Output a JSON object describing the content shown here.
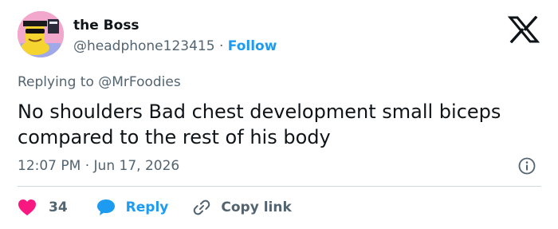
{
  "author": {
    "name": "the Boss",
    "handle": "@headphone123415",
    "separator": "·",
    "follow_label": "Follow"
  },
  "reply_context": {
    "prefix": "Replying to",
    "mention": "@MrFoodies"
  },
  "tweet": {
    "text": "No shoulders Bad chest development small biceps compared to the rest of his body",
    "time": "12:07 PM",
    "separator": "·",
    "date": "Jun 17, 2026"
  },
  "actions": {
    "like_count": "34",
    "reply_label": "Reply",
    "copy_label": "Copy link"
  },
  "icons": {
    "logo": "x-logo-icon",
    "info": "info-icon",
    "like": "heart-icon",
    "reply": "speech-bubble-icon",
    "copy": "link-icon"
  },
  "colors": {
    "accent": "#1d9bf0",
    "like": "#f91880",
    "secondary_text": "#536471",
    "primary_text": "#0f1419",
    "avatar_bg": "#f4a6c8"
  }
}
